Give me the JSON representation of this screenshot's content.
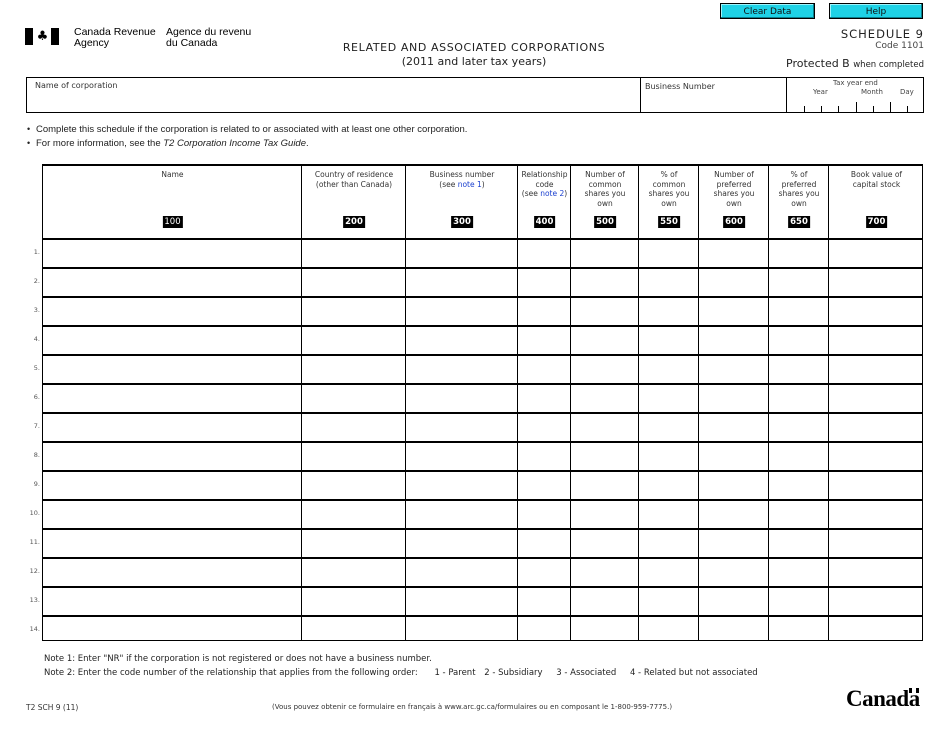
{
  "toolbar": {
    "clear_label": "Clear Data",
    "help_label": "Help"
  },
  "header": {
    "agency_en": [
      "Canada Revenue",
      "Agency"
    ],
    "agency_fr": [
      "Agence du revenu",
      "du Canada"
    ],
    "title": "RELATED AND ASSOCIATED CORPORATIONS",
    "subtitle": "(2011 and later tax years)",
    "schedule": "SCHEDULE 9",
    "code": "Code 1101",
    "protected": "Protected B",
    "protected_suffix": "when completed"
  },
  "identification": {
    "name_label": "Name of corporation",
    "name_value": "",
    "bn_label": "Business Number",
    "bn_value": "",
    "tax_year_end_label": "Tax year end",
    "year_label": "Year",
    "month_label": "Month",
    "day_label": "Day"
  },
  "instructions": [
    "Complete this schedule if the corporation is related to or associated with at least one other corporation.",
    {
      "prefix": "For more information, see the ",
      "italic": "T2 Corporation Income Tax Guide",
      "suffix": "."
    }
  ],
  "table": {
    "columns": [
      {
        "header": [
          "Name"
        ],
        "code": "100"
      },
      {
        "header": [
          "Country of residence",
          "(other than Canada)"
        ],
        "code": "200"
      },
      {
        "header": [
          "Business number"
        ],
        "see": "(see ",
        "note": "note 1",
        "close": ")",
        "code": "300"
      },
      {
        "header": [
          "Relationship",
          "code"
        ],
        "see": "(see ",
        "note": "note 2",
        "close": ")",
        "code": "400"
      },
      {
        "header": [
          "Number of",
          "common",
          "shares you",
          "own"
        ],
        "code": "500"
      },
      {
        "header": [
          "% of",
          "common",
          "shares you",
          "own"
        ],
        "code": "550"
      },
      {
        "header": [
          "Number of",
          "preferred",
          "shares you",
          "own"
        ],
        "code": "600"
      },
      {
        "header": [
          "% of",
          "preferred",
          "shares you",
          "own"
        ],
        "code": "650"
      },
      {
        "header": [
          "Book value of",
          "capital stock"
        ],
        "code": "700"
      }
    ],
    "row_labels": [
      "1.",
      "2.",
      "3.",
      "4.",
      "5.",
      "6.",
      "7.",
      "8.",
      "9.",
      "10.",
      "11.",
      "12.",
      "13.",
      "14."
    ],
    "rows": [
      [
        "",
        "",
        "",
        "",
        "",
        "",
        "",
        "",
        ""
      ],
      [
        "",
        "",
        "",
        "",
        "",
        "",
        "",
        "",
        ""
      ],
      [
        "",
        "",
        "",
        "",
        "",
        "",
        "",
        "",
        ""
      ],
      [
        "",
        "",
        "",
        "",
        "",
        "",
        "",
        "",
        ""
      ],
      [
        "",
        "",
        "",
        "",
        "",
        "",
        "",
        "",
        ""
      ],
      [
        "",
        "",
        "",
        "",
        "",
        "",
        "",
        "",
        ""
      ],
      [
        "",
        "",
        "",
        "",
        "",
        "",
        "",
        "",
        ""
      ],
      [
        "",
        "",
        "",
        "",
        "",
        "",
        "",
        "",
        ""
      ],
      [
        "",
        "",
        "",
        "",
        "",
        "",
        "",
        "",
        ""
      ],
      [
        "",
        "",
        "",
        "",
        "",
        "",
        "",
        "",
        ""
      ],
      [
        "",
        "",
        "",
        "",
        "",
        "",
        "",
        "",
        ""
      ],
      [
        "",
        "",
        "",
        "",
        "",
        "",
        "",
        "",
        ""
      ],
      [
        "",
        "",
        "",
        "",
        "",
        "",
        "",
        "",
        ""
      ],
      [
        "",
        "",
        "",
        "",
        "",
        "",
        "",
        "",
        ""
      ]
    ]
  },
  "notes": {
    "note1": "Note 1: Enter \"NR\" if the corporation is not registered or does not have a business number.",
    "note2": "Note 2: Enter the code number of the relationship that applies from the following order:",
    "relationship_options": [
      "1 - Parent",
      "2 - Subsidiary",
      "3 - Associated",
      "4 - Related but not associated"
    ]
  },
  "footer": {
    "form_id": "T2 SCH 9 (11)",
    "french_note": "(Vous pouvez obtenir ce formulaire en français à www.arc.gc.ca/formulaires ou en composant le 1-800-959-7775.)",
    "wordmark": "Canada"
  }
}
